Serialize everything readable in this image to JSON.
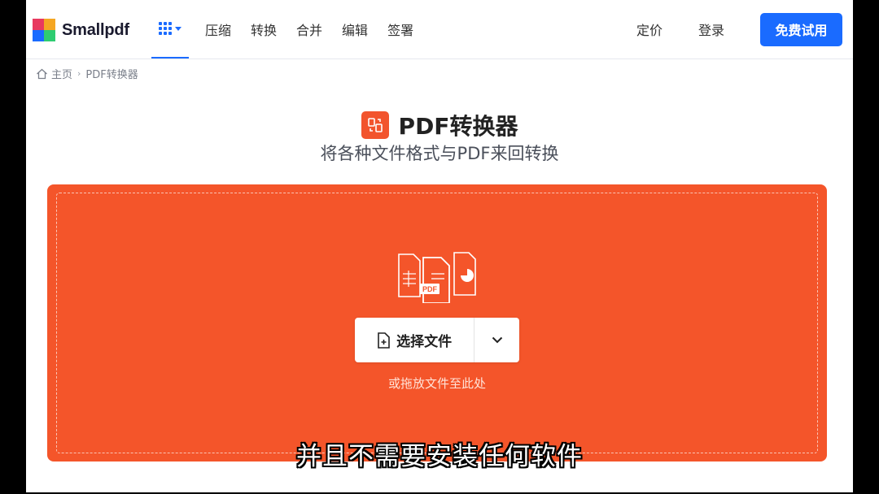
{
  "brand": {
    "name": "Smallpdf",
    "logo_colors": [
      "#e83a5f",
      "#f5a623",
      "#1a6bff",
      "#2ecc71"
    ]
  },
  "nav": {
    "apps_icon": "grid-icon",
    "items": [
      "压缩",
      "转换",
      "合并",
      "编辑",
      "签署"
    ],
    "pricing": "定价",
    "login": "登录",
    "trial_button": "免费试用"
  },
  "breadcrumb": {
    "home_icon": "home-icon",
    "home": "主页",
    "separator": "›",
    "current": "PDF转换器"
  },
  "tool": {
    "icon": "convert-icon",
    "title": "PDF转换器",
    "subtitle": "将各种文件格式与PDF来回转换"
  },
  "dropzone": {
    "illustration_label": "PDF",
    "choose_button": "选择文件",
    "choose_icon": "file-add-icon",
    "dropdown_icon": "chevron-down-icon",
    "drag_hint": "或拖放文件至此处"
  },
  "caption": "并且不需要安装任何软件",
  "colors": {
    "accent": "#1a6bff",
    "dropzone": "#f4552a",
    "tool_icon_bg": "#f2542d"
  }
}
